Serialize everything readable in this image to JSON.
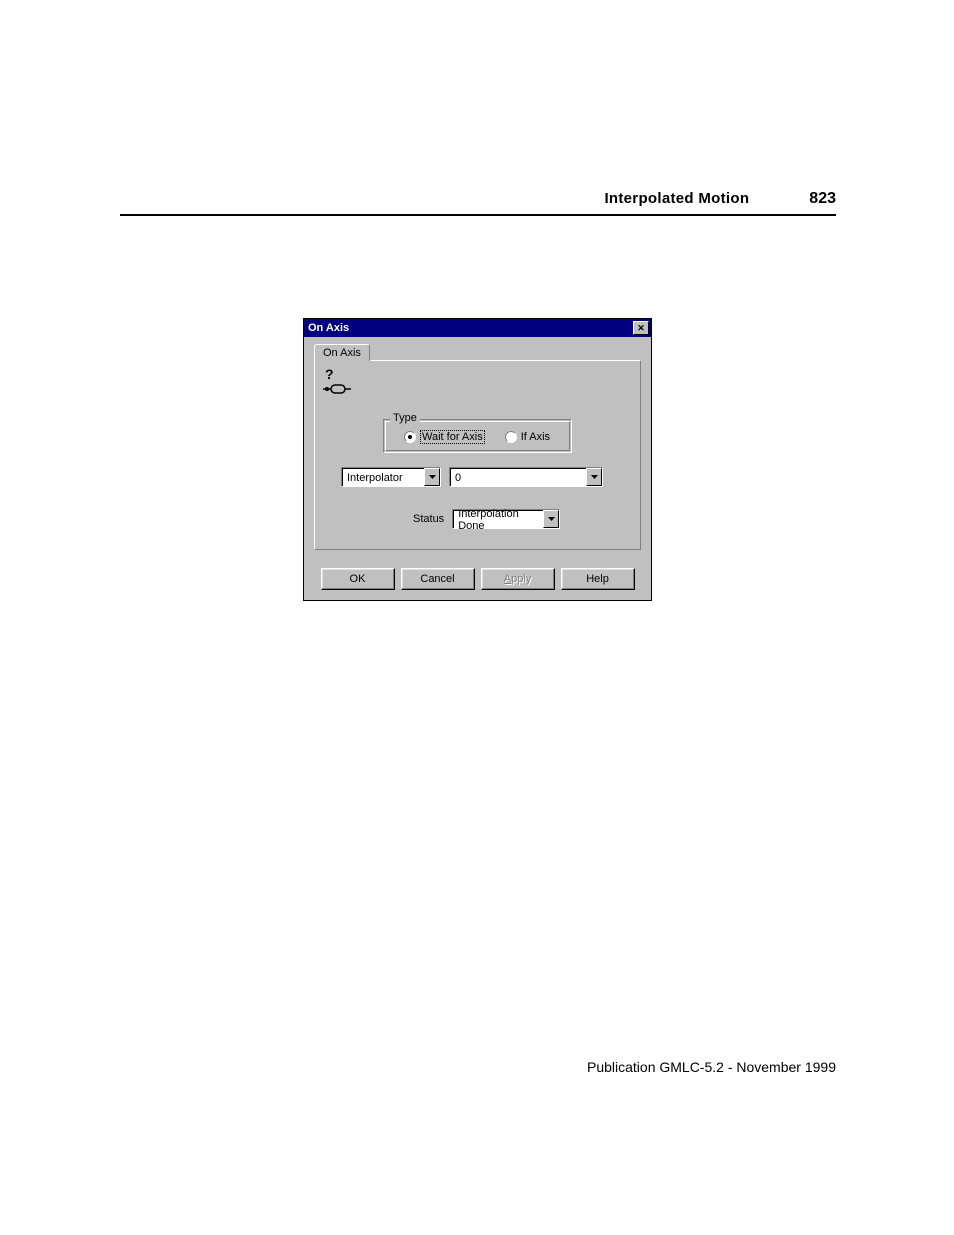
{
  "header": {
    "title": "Interpolated Motion",
    "page_number": "823"
  },
  "dialog": {
    "title": "On Axis",
    "tab_label": "On Axis",
    "type_group": {
      "legend": "Type",
      "wait_label": "Wait for Axis",
      "if_label": "If Axis"
    },
    "interpolator": {
      "value": "Interpolator",
      "number": "0"
    },
    "status": {
      "label": "Status",
      "value": "Interpolation Done"
    },
    "buttons": {
      "ok": "OK",
      "cancel": "Cancel",
      "apply_prefix": "A",
      "apply_rest": "pply",
      "help": "Help"
    }
  },
  "footer": "Publication GMLC-5.2 - November 1999"
}
